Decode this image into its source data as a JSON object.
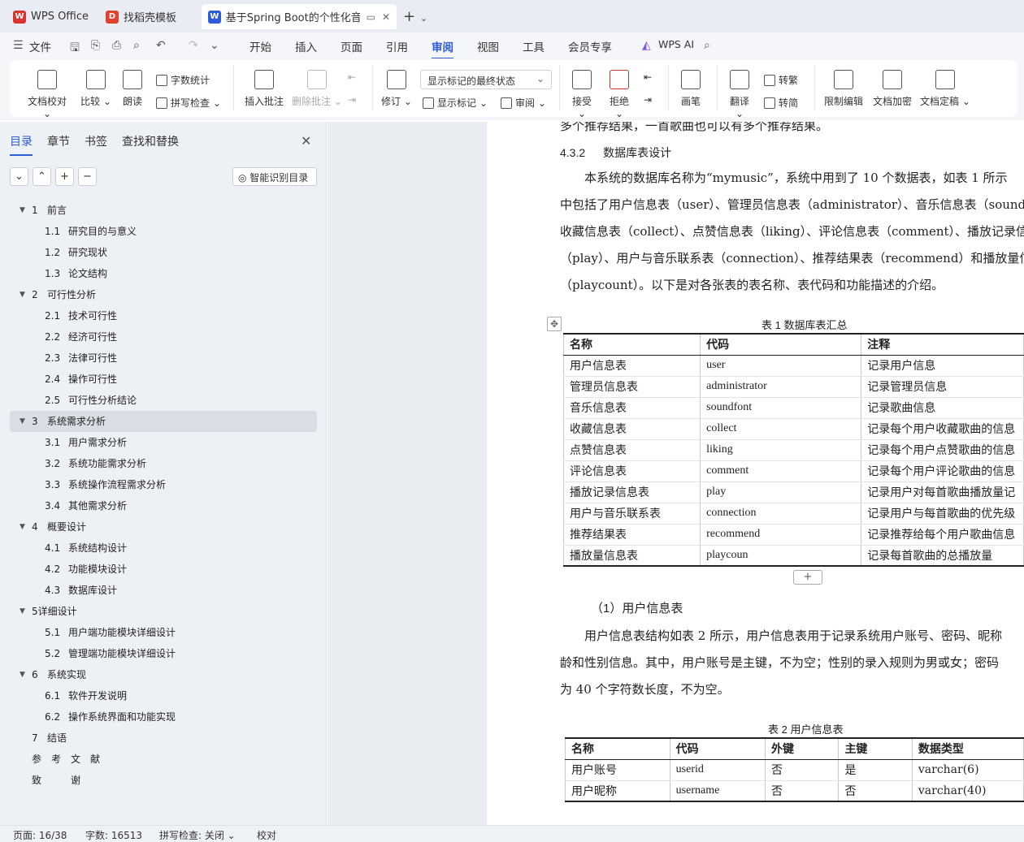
{
  "tabs": [
    {
      "label": "WPS Office",
      "icon": "wps-logo-icon",
      "color": "#d9342b"
    },
    {
      "label": "找稻壳模板",
      "icon": "docer-icon",
      "color": "#e2412f"
    },
    {
      "label": "基于Spring Boot的个性化音乐",
      "icon": "writer-icon",
      "color": "#2e5bd8"
    }
  ],
  "menubar": {
    "file": "文件",
    "items": [
      "开始",
      "插入",
      "页面",
      "引用",
      "审阅",
      "视图",
      "工具",
      "会员专享"
    ],
    "active": "审阅",
    "ai": "WPS AI"
  },
  "ribbon": {
    "doc_check": "文档校对",
    "compare": "比较",
    "read_aloud": "朗读",
    "word_count": "字数统计",
    "spell_check": "拼写检查",
    "insert_comment": "插入批注",
    "delete_comment": "删除批注",
    "revise": "修订",
    "markup_select": "显示标记的最终状态",
    "show_markup": "显示标记",
    "review": "审阅",
    "accept": "接受",
    "reject": "拒绝",
    "ink": "画笔",
    "translate": "翻译",
    "to_traditional": "转繁",
    "to_simplified": "转简",
    "restrict_edit": "限制编辑",
    "encrypt": "文档加密",
    "finalize": "文档定稿"
  },
  "nav": {
    "tabs": [
      "目录",
      "章节",
      "书签",
      "查找和替换"
    ],
    "smart_btn": "智能识别目录",
    "toc": [
      {
        "level": 1,
        "num": "1",
        "label": "前言",
        "arrow": true
      },
      {
        "level": 2,
        "num": "1.1",
        "label": "研究目的与意义"
      },
      {
        "level": 2,
        "num": "1.2",
        "label": "研究现状"
      },
      {
        "level": 2,
        "num": "1.3",
        "label": "论文结构"
      },
      {
        "level": 1,
        "num": "2",
        "label": "可行性分析",
        "arrow": true
      },
      {
        "level": 2,
        "num": "2.1",
        "label": "技术可行性"
      },
      {
        "level": 2,
        "num": "2.2",
        "label": "经济可行性"
      },
      {
        "level": 2,
        "num": "2.3",
        "label": "法律可行性"
      },
      {
        "level": 2,
        "num": "2.4",
        "label": "操作可行性"
      },
      {
        "level": 2,
        "num": "2.5",
        "label": "可行性分析结论"
      },
      {
        "level": 1,
        "num": "3",
        "label": "系统需求分析",
        "arrow": true,
        "selected": true
      },
      {
        "level": 2,
        "num": "3.1",
        "label": "用户需求分析"
      },
      {
        "level": 2,
        "num": "3.2",
        "label": "系统功能需求分析"
      },
      {
        "level": 2,
        "num": "3.3",
        "label": "系统操作流程需求分析"
      },
      {
        "level": 2,
        "num": "3.4",
        "label": "其他需求分析"
      },
      {
        "level": 1,
        "num": "4",
        "label": "概要设计",
        "arrow": true
      },
      {
        "level": 2,
        "num": "4.1",
        "label": "系统结构设计"
      },
      {
        "level": 2,
        "num": "4.2",
        "label": "功能模块设计"
      },
      {
        "level": 2,
        "num": "4.3",
        "label": "数据库设计"
      },
      {
        "level": 1,
        "num": "",
        "label": "5详细设计",
        "arrow": true
      },
      {
        "level": 2,
        "num": "5.1",
        "label": "用户端功能模块详细设计"
      },
      {
        "level": 2,
        "num": "5.2",
        "label": "管理端功能模块详细设计"
      },
      {
        "level": 1,
        "num": "6",
        "label": "系统实现",
        "arrow": true
      },
      {
        "level": 2,
        "num": "6.1",
        "label": "软件开发说明"
      },
      {
        "level": 2,
        "num": "6.2",
        "label": "操作系统界面和功能实现"
      },
      {
        "level": 1,
        "num": "7",
        "label": "结语"
      },
      {
        "level": 1,
        "num": "",
        "label": "参　考　文　献"
      },
      {
        "level": 1,
        "num": "",
        "label": "致　　　谢"
      }
    ]
  },
  "doc": {
    "top_line": "多个推荐结果，一首歌曲也可以有多个推荐结果。",
    "heading_num": "4.3.2",
    "heading": "数据库表设计",
    "para1": [
      "　　本系统的数据库名称为“mymusic”，系统中用到了 10 个数据表，如表 1 所示",
      "中包括了用户信息表（user）、管理员信息表（administrator）、音乐信息表（soundf",
      "收藏信息表（collect）、点赞信息表（liking）、评论信息表（comment）、播放记录信",
      "（play）、用户与音乐联系表（connection）、推荐结果表（recommend）和播放量信",
      "（playcount）。以下是对各张表的表名称、表代码和功能描述的介绍。"
    ],
    "table1_caption": "表 1 数据库表汇总",
    "table1_headers": [
      "名称",
      "代码",
      "注释"
    ],
    "table1_rows": [
      [
        "用户信息表",
        "user",
        "记录用户信息"
      ],
      [
        "管理员信息表",
        "administrator",
        "记录管理员信息"
      ],
      [
        "音乐信息表",
        "soundfont",
        "记录歌曲信息"
      ],
      [
        "收藏信息表",
        "collect",
        "记录每个用户收藏歌曲的信息"
      ],
      [
        "点赞信息表",
        "liking",
        "记录每个用户点赞歌曲的信息"
      ],
      [
        "评论信息表",
        "comment",
        "记录每个用户评论歌曲的信息"
      ],
      [
        "播放记录信息表",
        "play",
        "记录用户对每首歌曲播放量记"
      ],
      [
        "用户与音乐联系表",
        "connection",
        "记录用户与每首歌曲的优先级"
      ],
      [
        "推荐结果表",
        "recommend",
        "记录推荐给每个用户歌曲信息"
      ],
      [
        "播放量信息表",
        "playcoun",
        "记录每首歌曲的总播放量"
      ]
    ],
    "sub_heading": "（1）用户信息表",
    "para2": [
      "　　用户信息表结构如表 2 所示，用户信息表用于记录系统用户账号、密码、昵称",
      "龄和性别信息。其中，用户账号是主键，不为空；性别的录入规则为男或女；密码",
      "为 40 个字符数长度，不为空。"
    ],
    "table2_caption": "表 2 用户信息表",
    "table2_headers": [
      "名称",
      "代码",
      "外键",
      "主键",
      "数据类型"
    ],
    "table2_rows": [
      [
        "用户账号",
        "userid",
        "否",
        "是",
        "varchar(6)"
      ],
      [
        "用户昵称",
        "username",
        "否",
        "否",
        "varchar(40)"
      ]
    ]
  },
  "status": {
    "page": "页面: 16/38",
    "words": "字数: 16513",
    "spell": "拼写检查: 关闭",
    "proof": "校对"
  },
  "colors": {
    "accent": "#2e5bd8",
    "nav_bg": "#edf1f5",
    "gutter_bg": "#e9edf2"
  }
}
